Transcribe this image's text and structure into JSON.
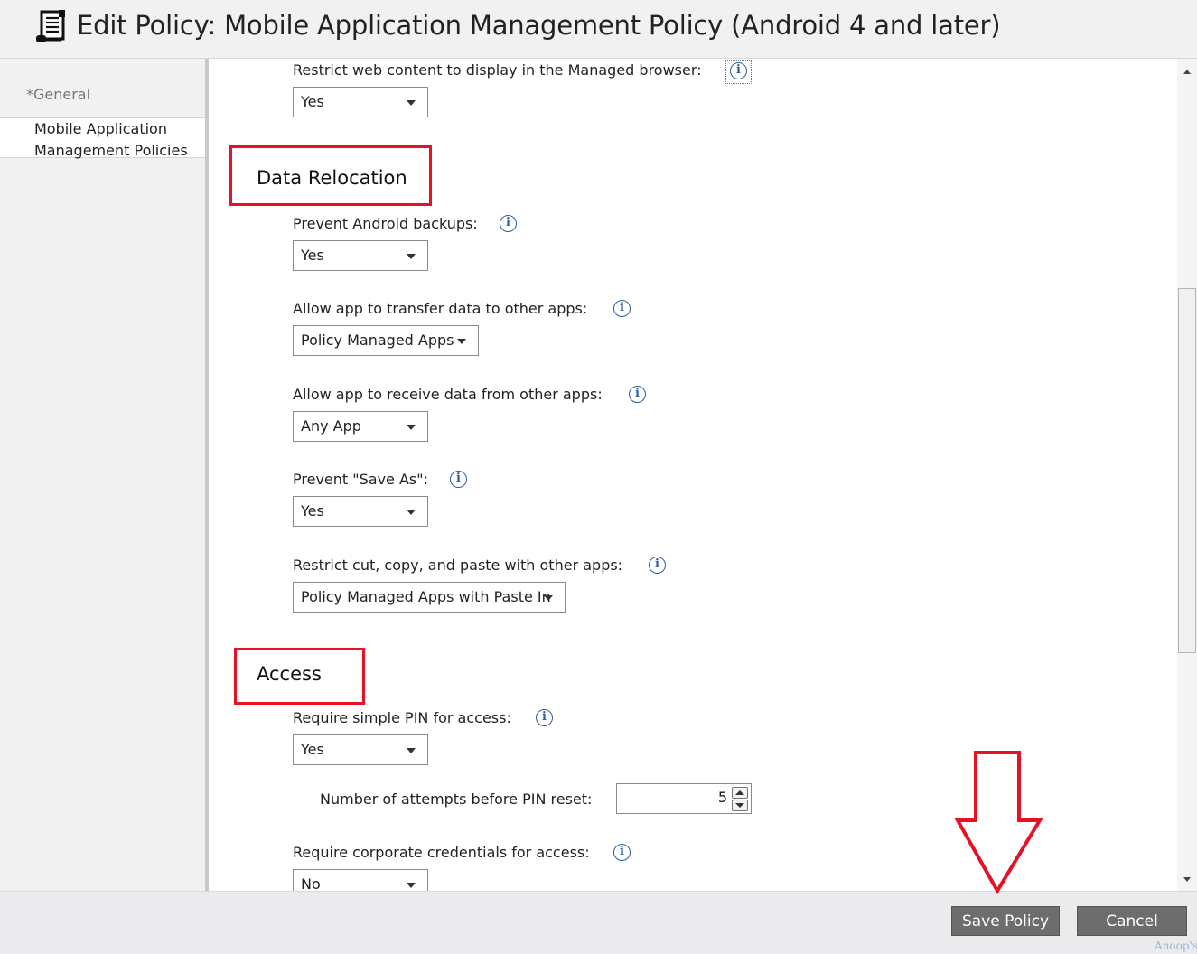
{
  "window": {
    "title": "Edit Policy: Mobile Application Management Policy (Android 4 and later)",
    "icon": "policy-scroll-icon"
  },
  "sidebar": {
    "general_label": "*General",
    "items": [
      {
        "label_line1": "Mobile Application",
        "label_line2": "Management Policies"
      }
    ]
  },
  "fields": {
    "restrict_web": {
      "label": "Restrict web content to display in the Managed browser:",
      "value": "Yes"
    },
    "prevent_backups": {
      "label": "Prevent Android backups:",
      "value": "Yes"
    },
    "transfer_data": {
      "label": "Allow app to transfer data to other apps:",
      "value": "Policy Managed Apps"
    },
    "receive_data": {
      "label": "Allow app to receive data from other apps:",
      "value": "Any App"
    },
    "prevent_save_as": {
      "label": "Prevent \"Save As\":",
      "value": "Yes"
    },
    "restrict_cut_copy": {
      "label": "Restrict cut, copy, and paste with other apps:",
      "value": "Policy Managed Apps with Paste In"
    },
    "simple_pin": {
      "label": "Require simple PIN for access:",
      "value": "Yes"
    },
    "pin_attempts": {
      "label": "Number of attempts before PIN reset:",
      "value": "5"
    },
    "corporate_credentials": {
      "label": "Require corporate credentials for access:",
      "value": "No"
    }
  },
  "sections": {
    "data_relocation": "Data Relocation",
    "access": "Access"
  },
  "footer": {
    "save_label": "Save Policy",
    "cancel_label": "Cancel"
  },
  "watermark": "Anoop's",
  "colors": {
    "highlight_red": "#e81123",
    "button_gray": "#6d6d6d",
    "info_blue": "#2f5e9a"
  }
}
